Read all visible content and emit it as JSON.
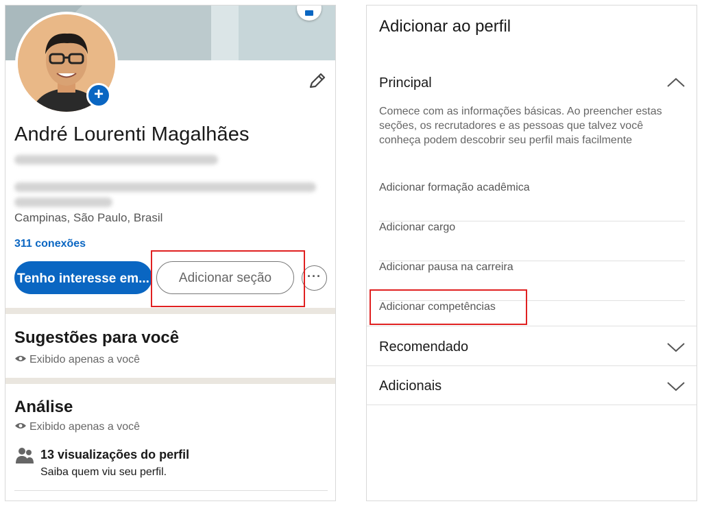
{
  "profile": {
    "name": "André Lourenti Magalhães",
    "location": "Campinas, São Paulo, Brasil",
    "connections": "311 conexões",
    "btn_interest": "Tenho interesse em...",
    "btn_add_section": "Adicionar seção",
    "btn_more": "···"
  },
  "suggestions": {
    "title": "Sugestões para você",
    "visibility": "Exibido apenas a você"
  },
  "analysis": {
    "title": "Análise",
    "visibility": "Exibido apenas a você",
    "stat_title": "13 visualizações do perfil",
    "stat_sub": "Saiba quem viu seu perfil."
  },
  "add_profile": {
    "title": "Adicionar ao perfil",
    "principal": "Principal",
    "description": "Comece com as informações básicas. Ao preencher estas seções, os recrutadores e as pessoas que talvez você conheça podem descobrir seu perfil mais facilmente",
    "items": [
      "Adicionar formação acadêmica",
      "Adicionar cargo",
      "Adicionar pausa na carreira",
      "Adicionar competências"
    ],
    "recommended": "Recomendado",
    "additional": "Adicionais"
  },
  "colors": {
    "accent": "#0a66c2",
    "highlight": "#e02020"
  }
}
